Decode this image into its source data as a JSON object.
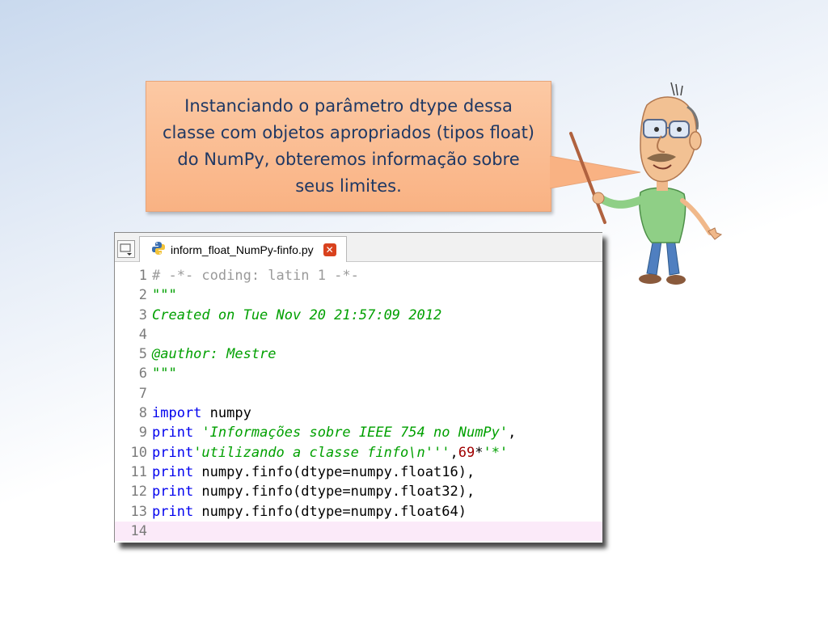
{
  "callout": {
    "text": "Instanciando o parâmetro dtype dessa classe com objetos apropriados (tipos float) do NumPy, obteremos informação sobre seus limites."
  },
  "editor": {
    "tab_title": "inform_float_NumPy-finfo.py",
    "lines": [
      {
        "n": "1",
        "parts": [
          {
            "t": "# -*- coding: latin 1 -*-",
            "c": "comment"
          }
        ]
      },
      {
        "n": "2",
        "parts": [
          {
            "t": "\"\"\"",
            "c": "str"
          }
        ]
      },
      {
        "n": "3",
        "parts": [
          {
            "t": "Created on Tue Nov 20 21:57:09 2012",
            "c": "str"
          }
        ]
      },
      {
        "n": "4",
        "parts": []
      },
      {
        "n": "5",
        "parts": [
          {
            "t": "@author: Mestre",
            "c": "str"
          }
        ]
      },
      {
        "n": "6",
        "parts": [
          {
            "t": "\"\"\"",
            "c": "str"
          }
        ]
      },
      {
        "n": "7",
        "parts": []
      },
      {
        "n": "8",
        "parts": [
          {
            "t": "import",
            "c": "kw"
          },
          {
            "t": " numpy",
            "c": "plain"
          }
        ]
      },
      {
        "n": "9",
        "parts": [
          {
            "t": "print",
            "c": "kw"
          },
          {
            "t": " ",
            "c": "plain"
          },
          {
            "t": "'Informações sobre IEEE 754 no NumPy'",
            "c": "str"
          },
          {
            "t": ",",
            "c": "plain"
          }
        ]
      },
      {
        "n": "10",
        "parts": [
          {
            "t": "print",
            "c": "kw"
          },
          {
            "t": "'utilizando a classe finfo\\n'''",
            "c": "str"
          },
          {
            "t": ",",
            "c": "plain"
          },
          {
            "t": "69",
            "c": "num"
          },
          {
            "t": "*",
            "c": "plain"
          },
          {
            "t": "'*'",
            "c": "str"
          }
        ]
      },
      {
        "n": "11",
        "parts": [
          {
            "t": "print",
            "c": "kw"
          },
          {
            "t": " numpy.finfo(dtype=numpy.float16),",
            "c": "plain"
          }
        ]
      },
      {
        "n": "12",
        "parts": [
          {
            "t": "print",
            "c": "kw"
          },
          {
            "t": " numpy.finfo(dtype=numpy.float32),",
            "c": "plain"
          }
        ]
      },
      {
        "n": "13",
        "parts": [
          {
            "t": "print",
            "c": "kw"
          },
          {
            "t": " numpy.finfo(dtype=numpy.float64)",
            "c": "plain"
          }
        ]
      },
      {
        "n": "14",
        "parts": [],
        "current": true
      }
    ]
  },
  "colors": {
    "comment": "#9a9a9a",
    "string": "#00a000",
    "keyword": "#0000ee",
    "number": "#a00000",
    "callout_bg": "#f9b283",
    "callout_text": "#1f3864",
    "current_line": "#fbeaf9"
  },
  "icons": {
    "tab_file": "python-file-icon",
    "tab_close": "close-icon",
    "tab_menu": "tab-list-menu-icon"
  }
}
